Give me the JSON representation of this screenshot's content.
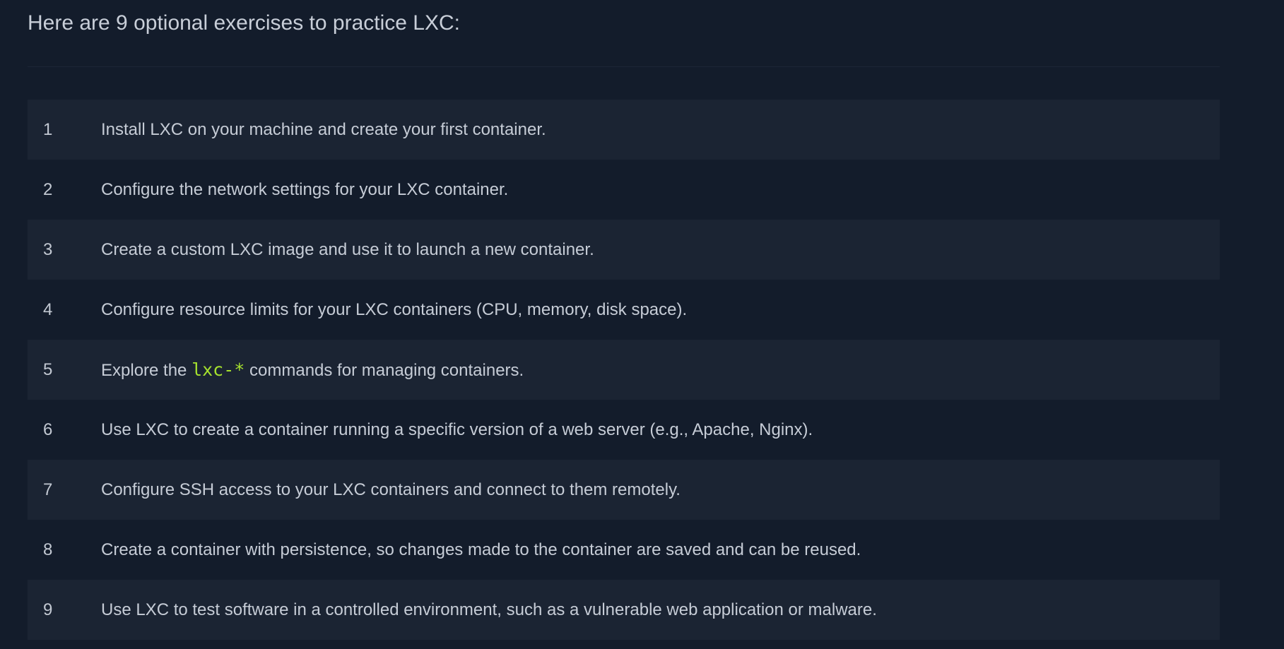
{
  "heading": "Here are 9 optional exercises to practice LXC:",
  "exercises": [
    {
      "number": "1",
      "text": "Install LXC on your machine and create your first container."
    },
    {
      "number": "2",
      "text": "Configure the network settings for your LXC container."
    },
    {
      "number": "3",
      "text": "Create a custom LXC image and use it to launch a new container."
    },
    {
      "number": "4",
      "text": "Configure resource limits for your LXC containers (CPU, memory, disk space)."
    },
    {
      "number": "5",
      "text_before": "Explore the ",
      "code": "lxc-*",
      "text_after": " commands for managing containers."
    },
    {
      "number": "6",
      "text": "Use LXC to create a container running a specific version of a web server (e.g., Apache, Nginx)."
    },
    {
      "number": "7",
      "text": "Configure SSH access to your LXC containers and connect to them remotely."
    },
    {
      "number": "8",
      "text": "Create a container with persistence, so changes made to the container are saved and can be reused."
    },
    {
      "number": "9",
      "text": "Use LXC to test software in a controlled environment, such as a vulnerable web application or malware."
    }
  ],
  "colors": {
    "background": "#131c2b",
    "row_shade": "#1b2433",
    "text": "#c6ccd6",
    "code": "#a6e22e"
  }
}
